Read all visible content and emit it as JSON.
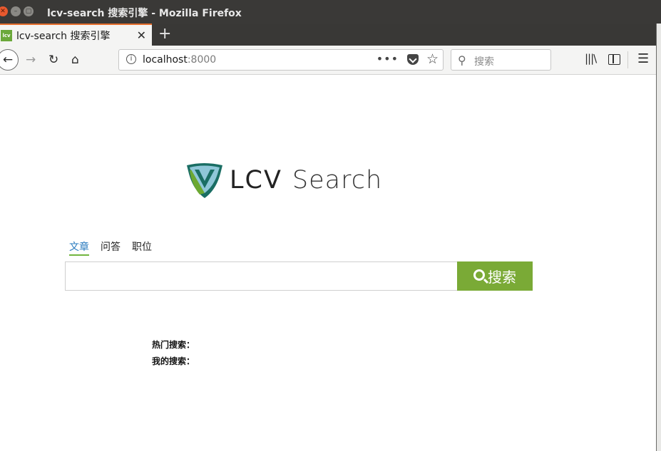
{
  "window": {
    "title": "lcv-search 搜索引擎 - Mozilla Firefox"
  },
  "tab": {
    "favicon_text": "lcv",
    "title": "lcv-search 搜索引擎",
    "close_glyph": "✕",
    "new_tab_glyph": "+"
  },
  "navbar": {
    "url_host": "localhost",
    "url_port": ":8000",
    "search_placeholder": "搜索"
  },
  "logo": {
    "brand": "LCV",
    "product": "Search",
    "colors": {
      "shield_outer": "#1a6e64",
      "shield_light": "#8fc7d8",
      "shield_green": "#6ca832"
    }
  },
  "search": {
    "tabs": [
      {
        "label": "文章",
        "active": true
      },
      {
        "label": "问答",
        "active": false
      },
      {
        "label": "职位",
        "active": false
      }
    ],
    "button_label": "搜索",
    "accent_color": "#7aaa36"
  },
  "sections": {
    "hot_label": "热门搜索：",
    "my_label": "我的搜索："
  }
}
